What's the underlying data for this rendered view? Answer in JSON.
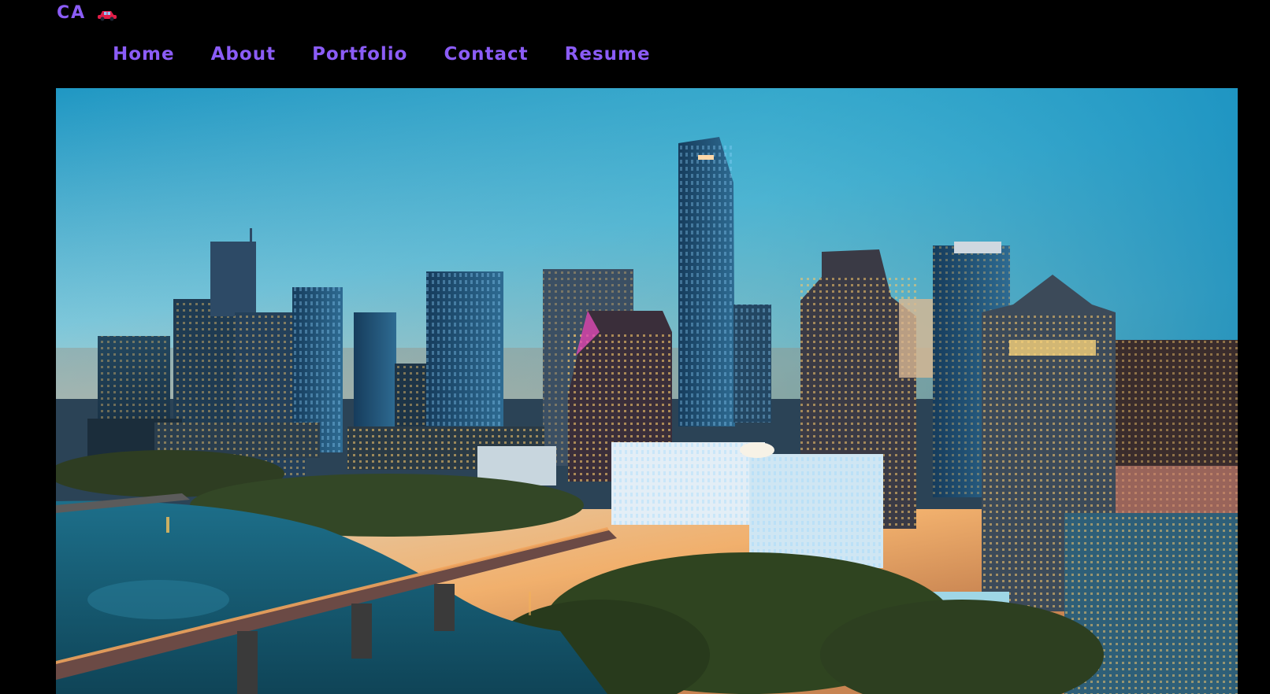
{
  "brand": {
    "text": "CA",
    "icon": "car-icon"
  },
  "nav": {
    "items": [
      {
        "label": "Home"
      },
      {
        "label": "About"
      },
      {
        "label": "Portfolio"
      },
      {
        "label": "Contact"
      },
      {
        "label": "Resume"
      }
    ]
  },
  "hero": {
    "subject": "city skyline at dusk with river and bridge"
  },
  "colors": {
    "background": "#000000",
    "accent": "#8b5cf6"
  }
}
